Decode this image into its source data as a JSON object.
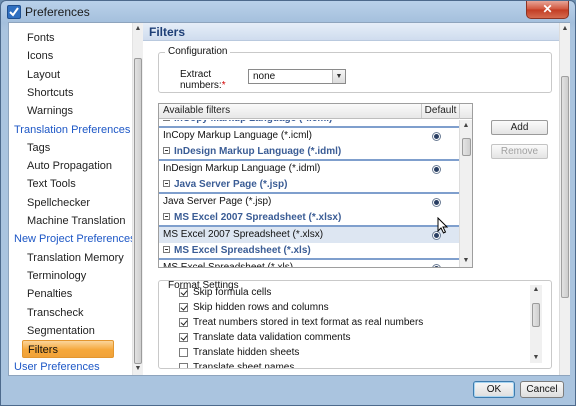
{
  "window": {
    "title": "Preferences",
    "close_glyph": "✕"
  },
  "nav": {
    "items": [
      {
        "label": "Fonts",
        "kind": "sub"
      },
      {
        "label": "Icons",
        "kind": "sub"
      },
      {
        "label": "Layout",
        "kind": "sub"
      },
      {
        "label": "Shortcuts",
        "kind": "sub"
      },
      {
        "label": "Warnings",
        "kind": "sub"
      },
      {
        "label": "Translation Preferences",
        "kind": "head"
      },
      {
        "label": "Tags",
        "kind": "sub"
      },
      {
        "label": "Auto Propagation",
        "kind": "sub"
      },
      {
        "label": "Text Tools",
        "kind": "sub"
      },
      {
        "label": "Spellchecker",
        "kind": "sub"
      },
      {
        "label": "Machine Translation",
        "kind": "sub"
      },
      {
        "label": "New Project Preferences",
        "kind": "head"
      },
      {
        "label": "Translation Memory",
        "kind": "sub"
      },
      {
        "label": "Terminology",
        "kind": "sub"
      },
      {
        "label": "Penalties",
        "kind": "sub"
      },
      {
        "label": "Transcheck",
        "kind": "sub"
      },
      {
        "label": "Segmentation",
        "kind": "sub"
      },
      {
        "label": "Filters",
        "kind": "sub",
        "selected": true
      },
      {
        "label": "User Preferences",
        "kind": "head"
      }
    ]
  },
  "page": {
    "title": "Filters"
  },
  "configuration": {
    "legend": "Configuration",
    "extract_label_line1": "Extract",
    "extract_label_line2": "numbers:",
    "required_mark": "*",
    "extract_value": "none"
  },
  "filters": {
    "header_name": "Available filters",
    "header_default": "Default",
    "rows": [
      {
        "type": "cat",
        "label": "InCopy Markup Language (*.icml)"
      },
      {
        "type": "item",
        "label": "InCopy Markup Language (*.icml)",
        "default": true
      },
      {
        "type": "cat",
        "label": "InDesign Markup Language (*.idml)"
      },
      {
        "type": "item",
        "label": "InDesign Markup Language (*.idml)",
        "default": true
      },
      {
        "type": "cat",
        "label": "Java Server Page (*.jsp)"
      },
      {
        "type": "item",
        "label": "Java Server Page (*.jsp)",
        "default": true
      },
      {
        "type": "cat",
        "label": "MS Excel 2007 Spreadsheet (*.xlsx)"
      },
      {
        "type": "item",
        "label": "MS Excel 2007 Spreadsheet (*.xlsx)",
        "default": true,
        "selected": true
      },
      {
        "type": "cat",
        "label": "MS Excel Spreadsheet (*.xls)"
      },
      {
        "type": "item",
        "label": "MS Excel Spreadsheet (*.xls)",
        "default": true
      }
    ]
  },
  "buttons": {
    "add": "Add",
    "remove": "Remove",
    "ok": "OK",
    "cancel": "Cancel"
  },
  "format_settings": {
    "legend": "Format Settings",
    "options": [
      {
        "label": "Skip formula cells",
        "checked": true
      },
      {
        "label": "Skip hidden rows and columns",
        "checked": true
      },
      {
        "label": "Treat numbers stored in text format as real numbers",
        "checked": true
      },
      {
        "label": "Translate data validation comments",
        "checked": true
      },
      {
        "label": "Translate hidden sheets",
        "checked": false
      },
      {
        "label": "Translate sheet names",
        "checked": false
      }
    ]
  },
  "colors": {
    "accent_selected": "#f6a83b",
    "link_blue": "#1d57c6",
    "header_blue": "#1e3f77"
  }
}
